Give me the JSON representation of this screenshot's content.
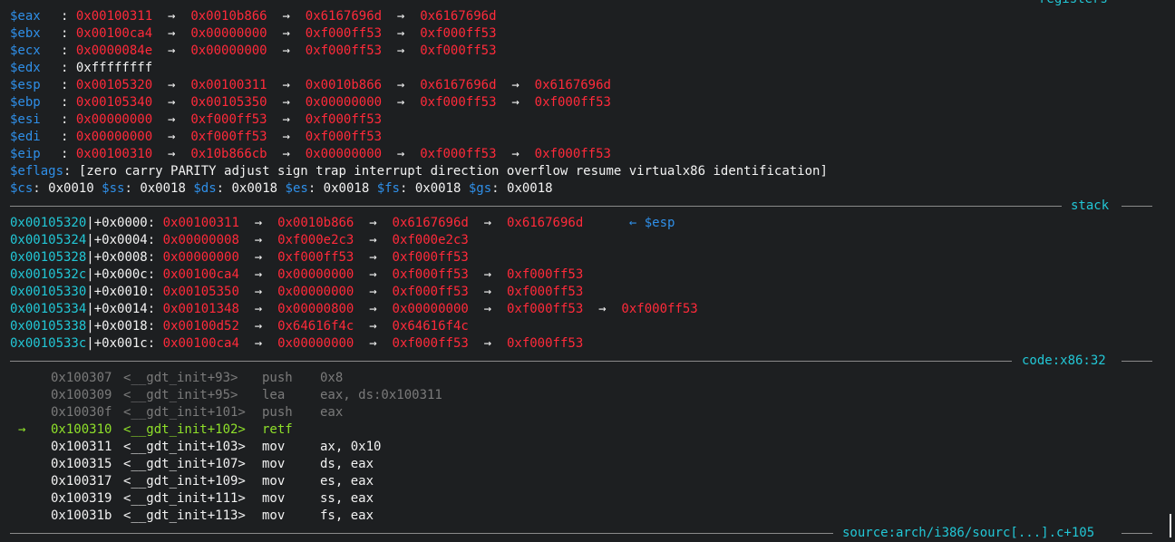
{
  "sections": {
    "registers_title": "registers",
    "stack_title": "stack",
    "code_title": "code:x86:32",
    "source_title": "source:arch/i386/sourc[...].c+105"
  },
  "arrow": "→",
  "left_arrow": "←",
  "registers": [
    {
      "name": "$eax",
      "chain": [
        "0x00100311",
        "0x0010b866",
        "0x6167696d",
        "0x6167696d"
      ]
    },
    {
      "name": "$ebx",
      "chain": [
        "0x00100ca4",
        "0x00000000",
        "0xf000ff53",
        "0xf000ff53"
      ]
    },
    {
      "name": "$ecx",
      "chain": [
        "0x0000084e",
        "0x00000000",
        "0xf000ff53",
        "0xf000ff53"
      ]
    },
    {
      "name": "$edx",
      "chain": [
        "0xffffffff"
      ],
      "plain": true
    },
    {
      "name": "$esp",
      "chain": [
        "0x00105320",
        "0x00100311",
        "0x0010b866",
        "0x6167696d",
        "0x6167696d"
      ]
    },
    {
      "name": "$ebp",
      "chain": [
        "0x00105340",
        "0x00105350",
        "0x00000000",
        "0xf000ff53",
        "0xf000ff53"
      ]
    },
    {
      "name": "$esi",
      "chain": [
        "0x00000000",
        "0xf000ff53",
        "0xf000ff53"
      ]
    },
    {
      "name": "$edi",
      "chain": [
        "0x00000000",
        "0xf000ff53",
        "0xf000ff53"
      ]
    },
    {
      "name": "$eip",
      "chain": [
        "0x00100310",
        "0x10b866cb",
        "0x00000000",
        "0xf000ff53",
        "0xf000ff53"
      ]
    }
  ],
  "eflags": {
    "name": "$eflags",
    "value": "[zero carry PARITY adjust sign trap interrupt direction overflow resume virtualx86 identification]"
  },
  "segments": [
    {
      "name": "$cs",
      "value": "0x0010"
    },
    {
      "name": "$ss",
      "value": "0x0018"
    },
    {
      "name": "$ds",
      "value": "0x0018"
    },
    {
      "name": "$es",
      "value": "0x0018"
    },
    {
      "name": "$fs",
      "value": "0x0018"
    },
    {
      "name": "$gs",
      "value": "0x0018"
    }
  ],
  "stack": [
    {
      "addr": "0x00105320",
      "offset": "+0x0000",
      "chain": [
        "0x00100311",
        "0x0010b866",
        "0x6167696d",
        "0x6167696d"
      ],
      "note": "$esp"
    },
    {
      "addr": "0x00105324",
      "offset": "+0x0004",
      "chain": [
        "0x00000008",
        "0xf000e2c3",
        "0xf000e2c3"
      ]
    },
    {
      "addr": "0x00105328",
      "offset": "+0x0008",
      "chain": [
        "0x00000000",
        "0xf000ff53",
        "0xf000ff53"
      ]
    },
    {
      "addr": "0x0010532c",
      "offset": "+0x000c",
      "chain": [
        "0x00100ca4",
        "0x00000000",
        "0xf000ff53",
        "0xf000ff53"
      ]
    },
    {
      "addr": "0x00105330",
      "offset": "+0x0010",
      "chain": [
        "0x00105350",
        "0x00000000",
        "0xf000ff53",
        "0xf000ff53"
      ]
    },
    {
      "addr": "0x00105334",
      "offset": "+0x0014",
      "chain": [
        "0x00101348",
        "0x00000800",
        "0x00000000",
        "0xf000ff53",
        "0xf000ff53"
      ]
    },
    {
      "addr": "0x00105338",
      "offset": "+0x0018",
      "chain": [
        "0x00100d52",
        "0x64616f4c",
        "0x64616f4c"
      ]
    },
    {
      "addr": "0x0010533c",
      "offset": "+0x001c",
      "chain": [
        "0x00100ca4",
        "0x00000000",
        "0xf000ff53",
        "0xf000ff53"
      ]
    }
  ],
  "code": [
    {
      "addr": "0x100307",
      "sym": "<__gdt_init+93>",
      "mnem": "push",
      "ops": "0x8",
      "state": "past"
    },
    {
      "addr": "0x100309",
      "sym": "<__gdt_init+95>",
      "mnem": "lea",
      "ops": "eax, ds:0x100311",
      "state": "past"
    },
    {
      "addr": "0x10030f",
      "sym": "<__gdt_init+101>",
      "mnem": "push",
      "ops": "eax",
      "state": "past"
    },
    {
      "addr": "0x100310",
      "sym": "<__gdt_init+102>",
      "mnem": "retf",
      "ops": "",
      "state": "current"
    },
    {
      "addr": "0x100311",
      "sym": "<__gdt_init+103>",
      "mnem": "mov",
      "ops": "ax, 0x10",
      "state": "future"
    },
    {
      "addr": "0x100315",
      "sym": "<__gdt_init+107>",
      "mnem": "mov",
      "ops": "ds, eax",
      "state": "future"
    },
    {
      "addr": "0x100317",
      "sym": "<__gdt_init+109>",
      "mnem": "mov",
      "ops": "es, eax",
      "state": "future"
    },
    {
      "addr": "0x100319",
      "sym": "<__gdt_init+111>",
      "mnem": "mov",
      "ops": "ss, eax",
      "state": "future"
    },
    {
      "addr": "0x10031b",
      "sym": "<__gdt_init+113>",
      "mnem": "mov",
      "ops": "fs, eax",
      "state": "future"
    }
  ],
  "colors": {
    "background": "#1d1f21",
    "register_name": "#2f8fe8",
    "pointer_value": "#ff2a3a",
    "section_title": "#22c7d6",
    "current_instruction": "#8fe02a",
    "past_instruction": "#7a7a7a"
  }
}
